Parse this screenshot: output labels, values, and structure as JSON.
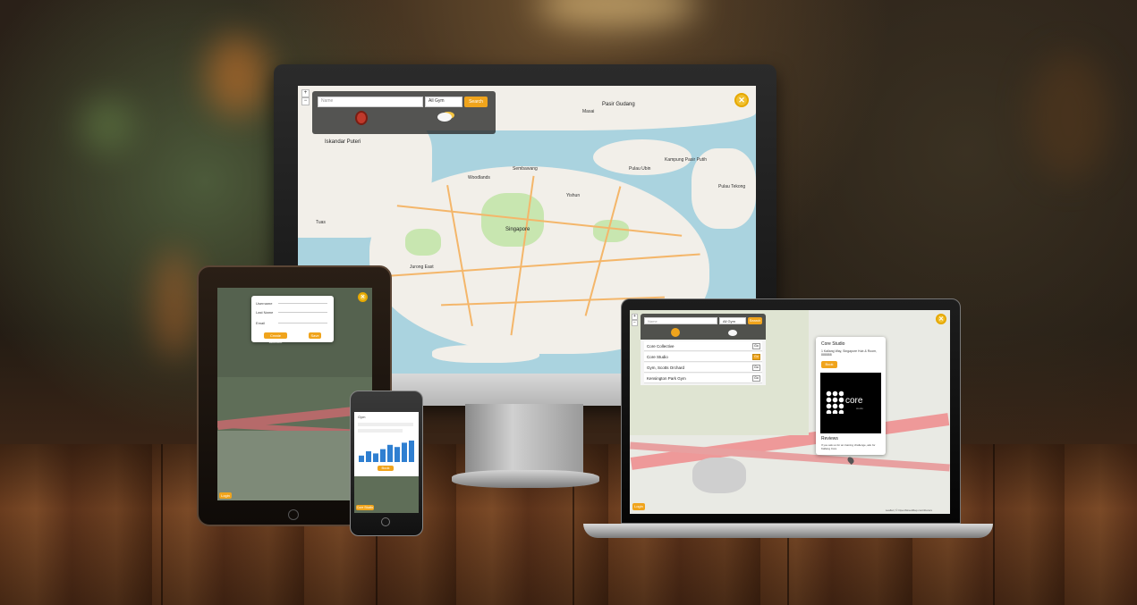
{
  "desktop": {
    "search": {
      "placeholder": "Name",
      "filter_value": "All Gym",
      "button_label": "Search"
    },
    "zoom": {
      "in": "+",
      "out": "−"
    },
    "close_icon": "✕",
    "map_labels": [
      "Pasir Gudang",
      "Masai",
      "Iskandar Puteri",
      "Singapore",
      "Jurong East",
      "Pulau Ubin",
      "Kampung Pasir Putih",
      "Woodlands",
      "Sembawang",
      "Yishun",
      "Pulau Tekong",
      "Tuas"
    ]
  },
  "tablet": {
    "dialog": {
      "fields": [
        "Username",
        "Last Name",
        "Email"
      ],
      "cancel_label": "Create Account",
      "ok_label": "Save"
    },
    "footer_label": "Login"
  },
  "phone": {
    "header": "Gym",
    "chart_values": [
      3,
      5,
      4,
      6,
      8,
      7,
      9,
      10
    ],
    "button_label": "Book",
    "footer_label": "Core Studio"
  },
  "laptop": {
    "search": {
      "placeholder": "Name",
      "filter_value": "All Gym",
      "button_label": "Search"
    },
    "gym_list": [
      {
        "name": "Core Collective",
        "action": "Go"
      },
      {
        "name": "Core Studio",
        "action": "Go"
      },
      {
        "name": "Gym, Scotts Orchard",
        "action": "Go"
      },
      {
        "name": "Kensington Park Gym",
        "action": "Go"
      }
    ],
    "popup": {
      "title": "Core Studio",
      "address": "1 Kallang Way, Singapore Hub & Room, 888888",
      "button_label": "Book",
      "logo_text": "core",
      "logo_sub": "studio",
      "reviews_title": "Reviews",
      "review_text": "If you ask us for an training challenge, ask for Kallang Core"
    },
    "footer_label": "Login",
    "attribution": "Leaflet | © OpenStreetMap contributors"
  },
  "colors": {
    "accent": "#f0a41c",
    "water": "#aad3df",
    "land": "#f2efe9",
    "dark_map": "#5f6e58"
  }
}
